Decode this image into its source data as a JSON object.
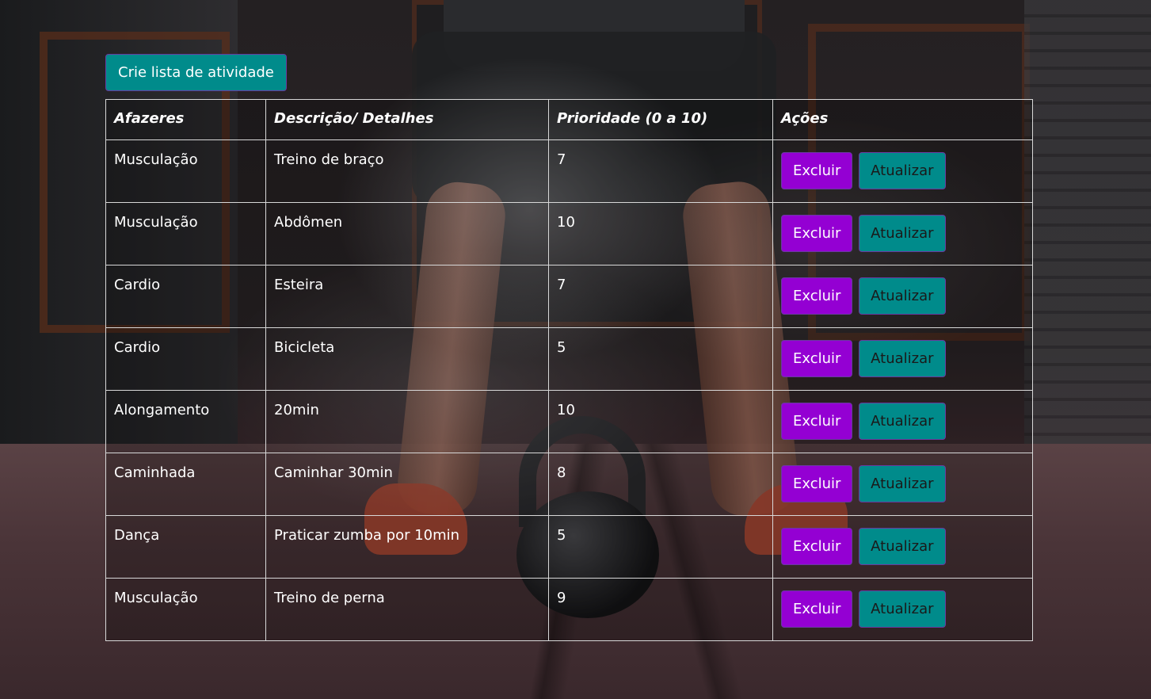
{
  "create_button": {
    "label": "Crie lista de atividade"
  },
  "table": {
    "headers": [
      "Afazeres",
      "Descrição/ Detalhes",
      "Prioridade (0 a 10)",
      "Ações"
    ],
    "rows": [
      {
        "task": "Musculação",
        "details": "Treino de braço",
        "priority": "7"
      },
      {
        "task": "Musculação",
        "details": "Abdômen",
        "priority": "10"
      },
      {
        "task": "Cardio",
        "details": "Esteira",
        "priority": "7"
      },
      {
        "task": "Cardio",
        "details": "Bicicleta",
        "priority": "5"
      },
      {
        "task": "Alongamento",
        "details": "20min",
        "priority": "10"
      },
      {
        "task": "Caminhada",
        "details": "Caminhar 30min",
        "priority": "8"
      },
      {
        "task": "Dança",
        "details": "Praticar zumba por 10min",
        "priority": "5"
      },
      {
        "task": "Musculação",
        "details": "Treino de perna",
        "priority": "9"
      }
    ],
    "delete_label": "Excluir",
    "update_label": "Atualizar"
  },
  "colors": {
    "primary_button": "#008b8b",
    "delete_button": "#9400d3",
    "button_border": "#6a3aa0"
  },
  "background": {
    "icon": "gym-kettlebell-photo"
  }
}
